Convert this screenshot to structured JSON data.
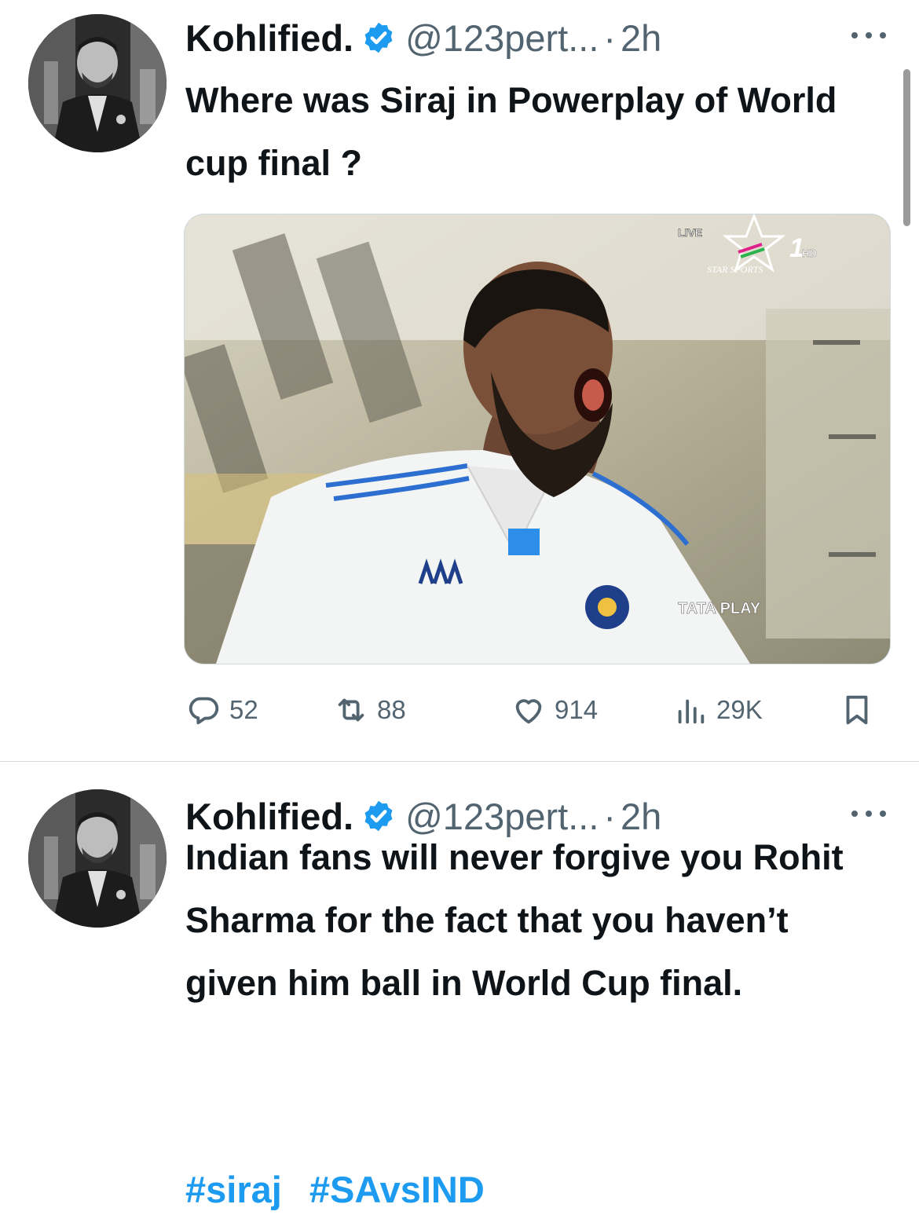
{
  "tweets": [
    {
      "author": {
        "name": "Kohlified.",
        "handle": "@123pert...",
        "verified": true,
        "avatar_icon": "profile-photo"
      },
      "separator": "·",
      "time": "2h",
      "more_icon": "more-horizontal-icon",
      "text": "Where was Siraj in Powerplay of World cup final ?",
      "media": {
        "broadcast_tag": "LIVE",
        "channel_label": "STAR SPORTS",
        "channel_number": "1",
        "channel_hd": "HD",
        "sponsor_label": "TATA PLAY"
      },
      "actions": {
        "replies": "52",
        "retweets": "88",
        "likes": "914",
        "views": "29K"
      }
    },
    {
      "author": {
        "name": "Kohlified.",
        "handle": "@123pert...",
        "verified": true,
        "avatar_icon": "profile-photo"
      },
      "separator": "·",
      "time": "2h",
      "more_icon": "more-horizontal-icon",
      "text": "Indian fans will never forgive you Rohit Sharma for the fact that you haven’t given him ball in World Cup final.",
      "hashtags": [
        "#siraj",
        "#SAvsIND"
      ]
    }
  ],
  "colors": {
    "accent": "#1d9bf0",
    "secondary_text": "#536471",
    "primary_text": "#0f1419",
    "divider": "#d8dde0"
  }
}
